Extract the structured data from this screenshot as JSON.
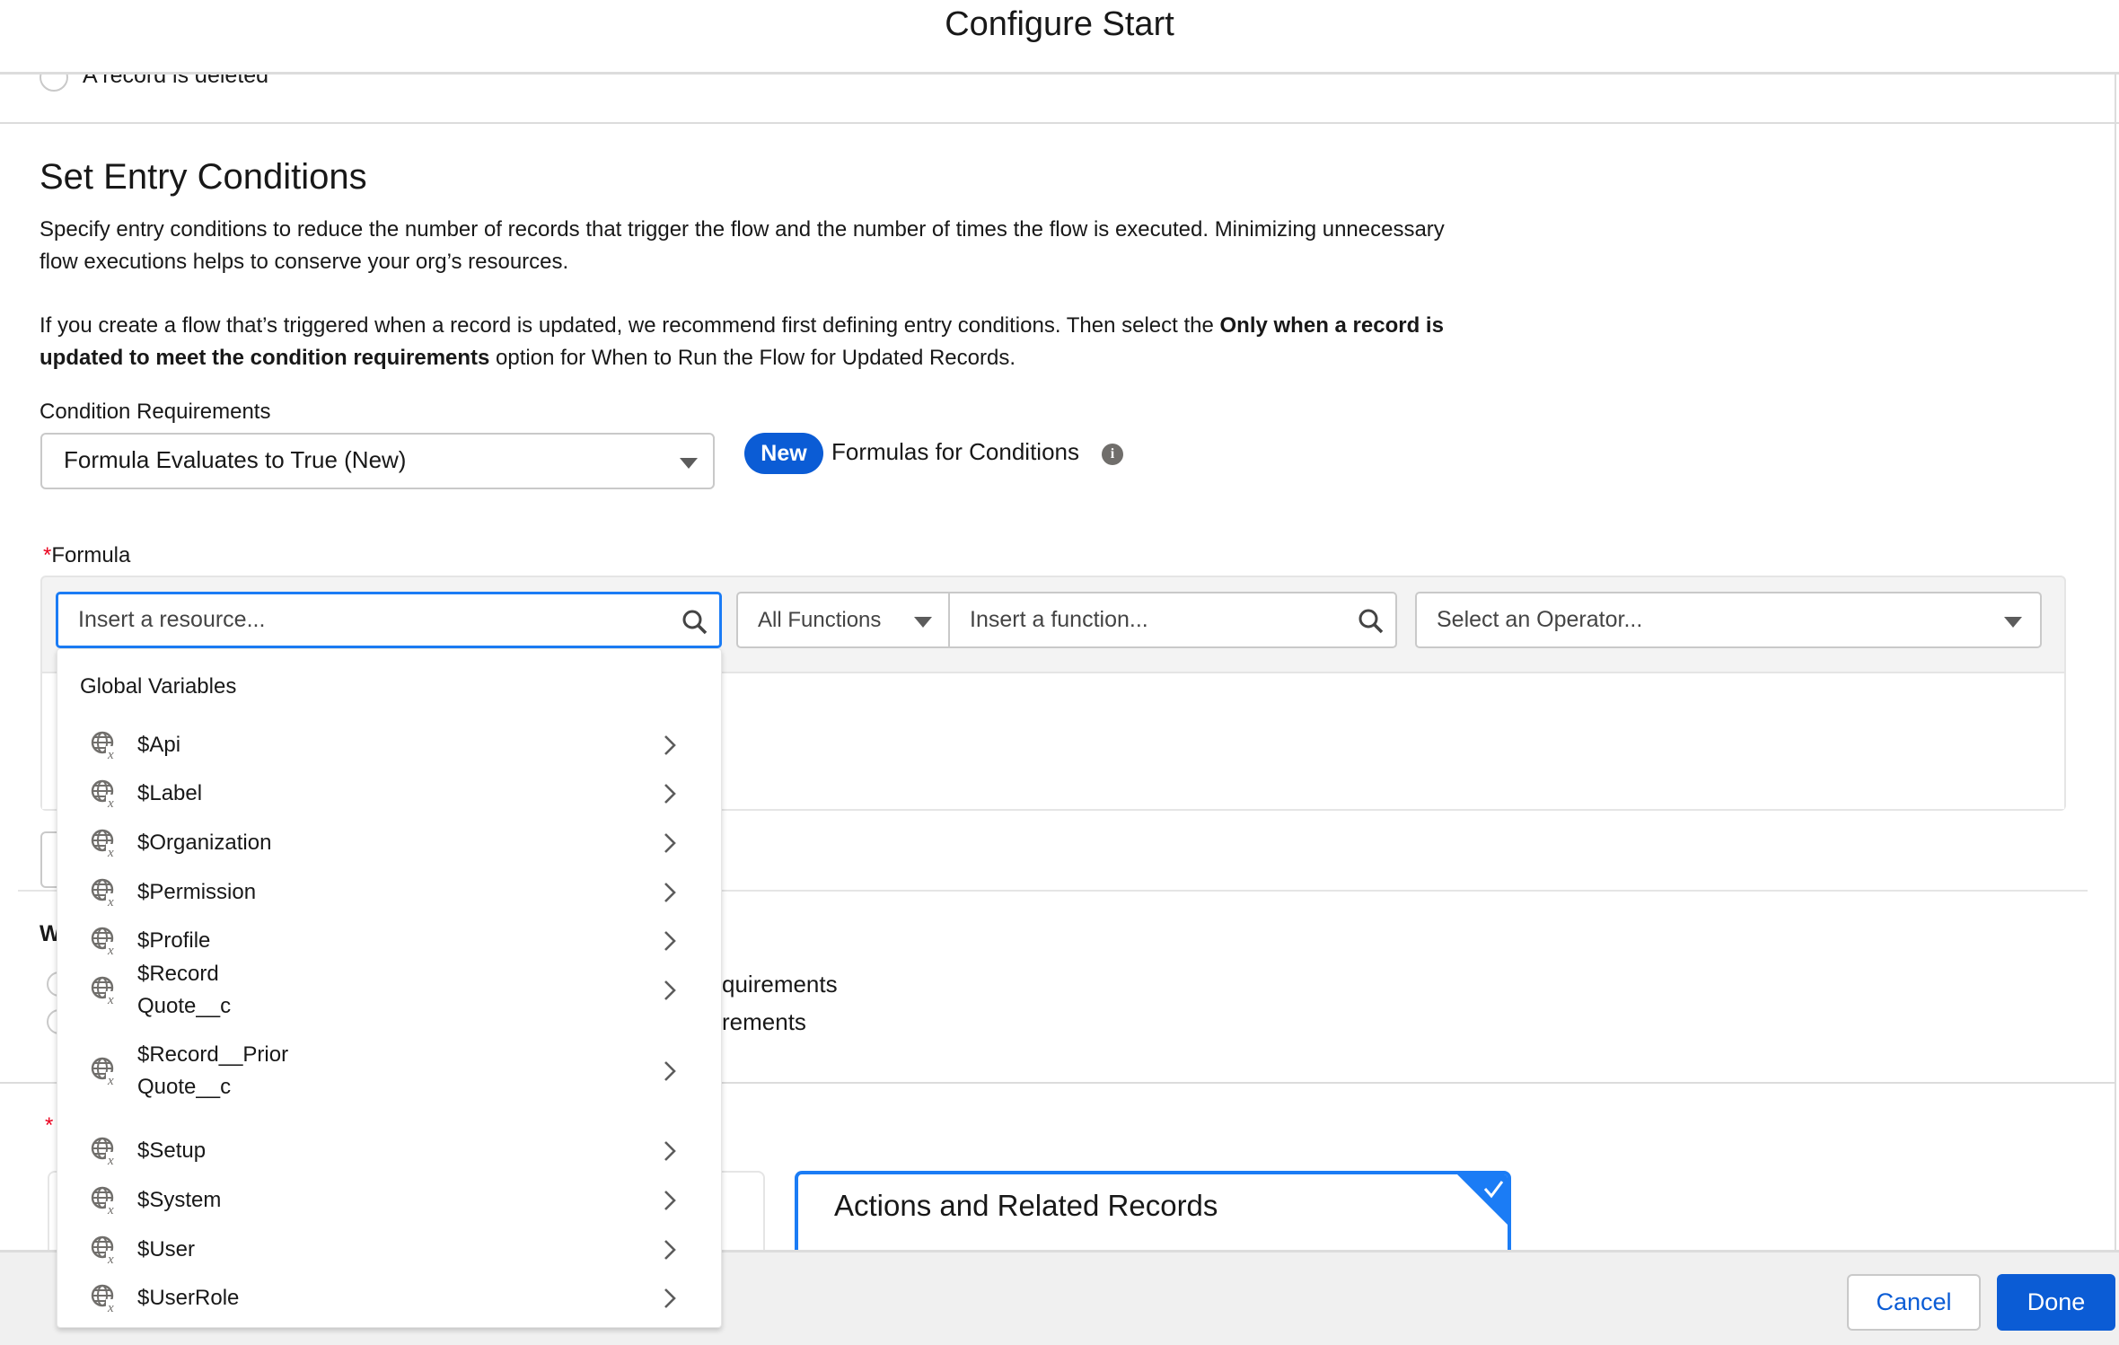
{
  "header": {
    "title": "Configure Start"
  },
  "trigger": {
    "deleted_option": "A record is deleted"
  },
  "entry": {
    "title": "Set Entry Conditions",
    "para1_line1": "Specify entry conditions to reduce the number of records that trigger the flow and the number of times the flow is executed. Minimizing unnecessary",
    "para1_line2": "flow executions helps to conserve your org’s resources.",
    "para2_line1_a": "If you create a flow that’s triggered when a record is updated, we recommend first defining entry conditions. Then select the ",
    "para2_line1_b": "Only when a record is",
    "para2_line2_a": "updated to meet the condition requirements",
    "para2_line2_b": " option for When to Run the Flow for Updated Records.",
    "condition_label": "Condition Requirements",
    "condition_value": "Formula Evaluates to True (New)",
    "new_badge": "New",
    "new_text": "Formulas for Conditions",
    "formula_required": "*",
    "formula_label": "Formula",
    "resource_placeholder": "Insert a resource...",
    "functions_filter": "All Functions",
    "function_placeholder": "Insert a function...",
    "operator_placeholder": "Select an Operator..."
  },
  "dropdown": {
    "group": "Global Variables",
    "items": [
      {
        "label": "$Api"
      },
      {
        "label": "$Label"
      },
      {
        "label": "$Organization"
      },
      {
        "label": "$Permission"
      },
      {
        "label": "$Profile"
      },
      {
        "label": "$Record",
        "sub": "Quote__c"
      },
      {
        "label": "$Record__Prior",
        "sub": "Quote__c"
      },
      {
        "label": "$Setup"
      },
      {
        "label": "$System"
      },
      {
        "label": "$User"
      },
      {
        "label": "$UserRole"
      }
    ]
  },
  "behind": {
    "when_heading_fragment": "W",
    "option1_fragment": "quirements",
    "option2_fragment": "rements",
    "required_mark": "*",
    "card_title": "Actions and Related Records"
  },
  "footer": {
    "cancel": "Cancel",
    "done": "Done"
  },
  "colors": {
    "brand": "#0b5cd5",
    "focus": "#1b7cf5",
    "required": "#ea001e"
  }
}
